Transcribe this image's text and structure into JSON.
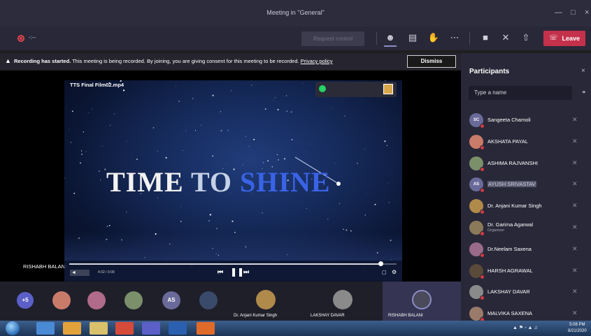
{
  "window": {
    "title": "Meeting in \"General\""
  },
  "toolbar": {
    "timer": "-:--",
    "request_control": "Request control",
    "leave": "Leave"
  },
  "banner": {
    "lead": "Recording has started.",
    "message": " This meeting is being recorded. By joining, you are giving consent for this meeting to be recorded. ",
    "privacy": "Privacy policy",
    "dismiss": "Dismiss"
  },
  "stage": {
    "video_name": "TTS Final Film02.mp4",
    "title_word1": "TIME",
    "title_word2": "TO",
    "title_word3": "SHINE",
    "speaker": "RISHABH BALANI",
    "time": "4:32 / 0:09",
    "progress": 0.95
  },
  "participants": {
    "title": "Participants",
    "search_placeholder": "Type a name",
    "list": [
      {
        "name": "Sangeeta Chamoli",
        "initials": "SC",
        "color": "#6a6a9a"
      },
      {
        "name": "AKSHATA PAYAL",
        "initials": "",
        "color": "#c97b6a"
      },
      {
        "name": "ASHIMA RAJVANSHI",
        "initials": "",
        "color": "#7a8f6a"
      },
      {
        "name": "AYUSH SRIVASTAV",
        "initials": "AS",
        "color": "#6a6a9a"
      },
      {
        "name": "Dr. Anjani Kumar Singh",
        "initials": "",
        "color": "#b08a4a"
      },
      {
        "name": "Dr. Garima Agarwal",
        "role": "Organizer",
        "initials": "",
        "color": "#8a7a5a"
      },
      {
        "name": "Dr.Neelam Saxena",
        "initials": "",
        "color": "#9a6a8a"
      },
      {
        "name": "HARSH AGRAWAL",
        "initials": "",
        "color": "#5a4a3a"
      },
      {
        "name": "LAKSHAY DAVAR",
        "initials": "",
        "color": "#8a8a8a"
      },
      {
        "name": "MALVIKA SAXENA",
        "initials": "",
        "color": "#9a7a6a"
      }
    ]
  },
  "gallery": {
    "overflow": "+5",
    "as_initials": "AS",
    "tile1": "Dr. Anjani Kumar Singh",
    "tile2": "LAKSHAY DAVAR",
    "tile3": "RISHABH BALANI"
  },
  "taskbar": {
    "time": "5:08 PM",
    "date": "8/21/2020"
  },
  "colors": {
    "accent": "#8b8cc7",
    "leave": "#c4314b",
    "mute_badge": "#d13a43"
  }
}
